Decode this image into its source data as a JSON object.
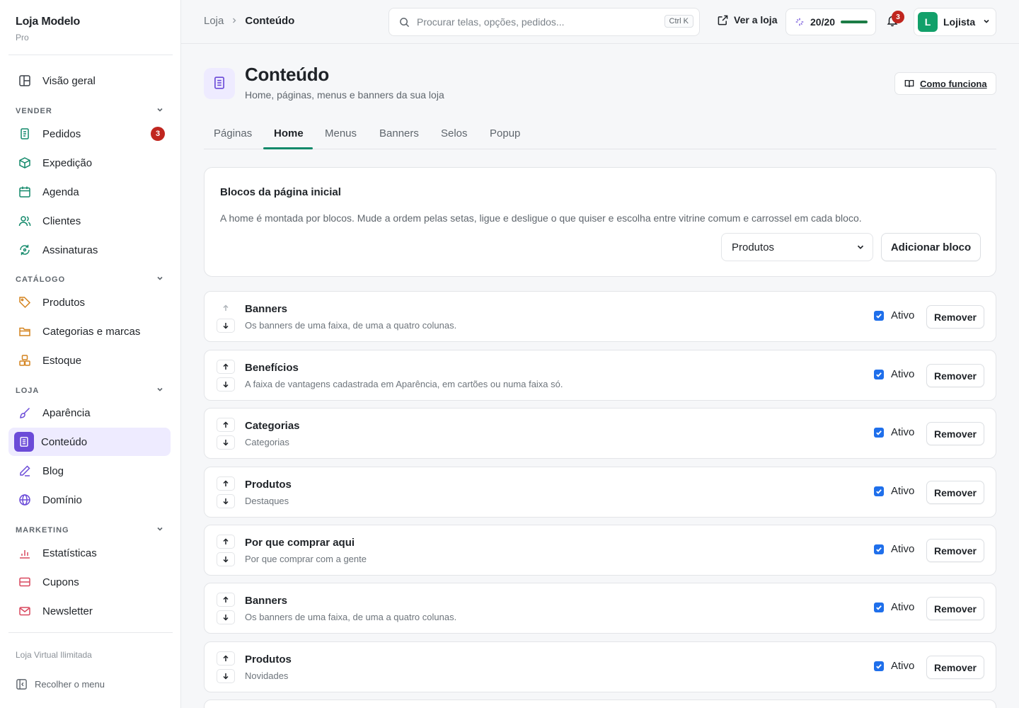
{
  "brand": {
    "name": "Loja Modelo",
    "plan": "Pro"
  },
  "sidebar": {
    "overview": "Visão geral",
    "sections": {
      "vender": "VENDER",
      "catalogo": "CATÁLOGO",
      "loja": "LOJA",
      "marketing": "MARKETING"
    },
    "items": {
      "pedidos": "Pedidos",
      "pedidos_badge": "3",
      "expedicao": "Expedição",
      "agenda": "Agenda",
      "clientes": "Clientes",
      "assinaturas": "Assinaturas",
      "produtos": "Produtos",
      "categorias": "Categorias e marcas",
      "estoque": "Estoque",
      "aparencia": "Aparência",
      "conteudo": "Conteúdo",
      "blog": "Blog",
      "dominio": "Domínio",
      "estatisticas": "Estatísticas",
      "cupons": "Cupons",
      "newsletter": "Newsletter"
    },
    "footer_label": "Loja Virtual Ilimitada",
    "collapse": "Recolher o menu"
  },
  "topbar": {
    "breadcrumb": [
      "Loja",
      "Conteúdo"
    ],
    "search_placeholder": "Procurar telas, opções, pedidos...",
    "search_shortcut": "Ctrl K",
    "view_store": "Ver a loja",
    "quota_text": "20/20",
    "quota_fraction": 1.0,
    "notifications_count": "3",
    "user_initial": "L",
    "user_name": "Lojista"
  },
  "page": {
    "title": "Conteúdo",
    "subtitle": "Home, páginas, menus e banners da sua loja",
    "how_it_works": "Como funciona"
  },
  "tabs": [
    "Páginas",
    "Home",
    "Menus",
    "Banners",
    "Selos",
    "Popup"
  ],
  "active_tab": "Home",
  "home_card": {
    "title": "Blocos da página inicial",
    "description": "A home é montada por blocos. Mude a ordem pelas setas, ligue e desligue o que quiser e escolha entre vitrine comum e carrossel em cada bloco.",
    "select_value": "Produtos",
    "add_button": "Adicionar bloco"
  },
  "block_labels": {
    "active": "Ativo",
    "remove": "Remover"
  },
  "blocks": [
    {
      "title": "Banners",
      "desc": "Os banners de uma faixa, de uma a quatro colunas.",
      "active": true
    },
    {
      "title": "Benefícios",
      "desc": "A faixa de vantagens cadastrada em Aparência, em cartões ou numa faixa só.",
      "active": true
    },
    {
      "title": "Categorias",
      "desc": "Categorias",
      "active": true
    },
    {
      "title": "Produtos",
      "desc": "Destaques",
      "active": true
    },
    {
      "title": "Por que comprar aqui",
      "desc": "Por que comprar com a gente",
      "active": true
    },
    {
      "title": "Banners",
      "desc": "Os banners de uma faixa, de uma a quatro colunas.",
      "active": true
    },
    {
      "title": "Produtos",
      "desc": "Novidades",
      "active": true
    }
  ],
  "colors": {
    "accent": "#6b4bd8",
    "accent_soft": "#eeebff",
    "success": "#12896a",
    "danger": "#c0261f",
    "checkbox": "#1f6feb"
  }
}
